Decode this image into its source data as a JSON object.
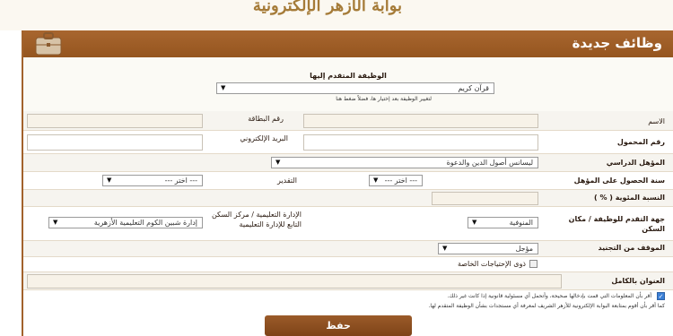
{
  "portal": {
    "logo_text": "بوابة الأزهر الإلكترونية"
  },
  "header": {
    "title": "وظائف جديدة",
    "briefcase_icon": "briefcase-icon"
  },
  "job": {
    "label": "الوظيفة المتقدم إليها",
    "selected": "قرآن كريم",
    "hint": "لتغيير الوظيفة بعد إختيار ها، فضلاً ضغط هنا"
  },
  "fields": {
    "name_label": "الاسم",
    "id_label": "رقم البطاقة",
    "mobile_label": "رقم المحمول",
    "email_label": "البريد الإلكتروني",
    "qualification_label": "المؤهل الدراسي",
    "qualification_value": "ليسانس أصول الدين والدعوة",
    "year_label": "سنة الحصول على المؤهل",
    "year_value": "--- اختر ---",
    "grade_label": "التقدير",
    "grade_value": "--- اختر ---",
    "percentage_label": "النسبة المئوية ( % )",
    "residence_label": "جهة التقدم للوظيفة / مكان السكن",
    "residence_value": "المنوفية",
    "admin_label": "الإدارة التعليمية / مركز السكن التابع للإدارة التعليمية",
    "admin_value": "إدارة شبين الكوم التعليمية الأزهرية",
    "military_label": "الموقف من التجنيد",
    "military_value": "مؤجل",
    "special_needs_label": "ذوى الإحتياجات الخاصة",
    "address_label": "العنوان بالكامل"
  },
  "agreement": {
    "line1": "أقر بأن المعلومات التي قمت بإدخالها صحيحة، وأتحمل أي مسئولية قانونية إذا كانت غير ذلك.",
    "line2": "كما أقر بأن أقوم بمتابعة البوابة الإلكترونية للأزهر الشريف لمعرفة أي مستجدات بشأن الوظيفة المتقدم لها."
  },
  "actions": {
    "save_label": "حفظ"
  },
  "colors": {
    "accent": "#a2622c",
    "accent_dark": "#7e4318"
  }
}
